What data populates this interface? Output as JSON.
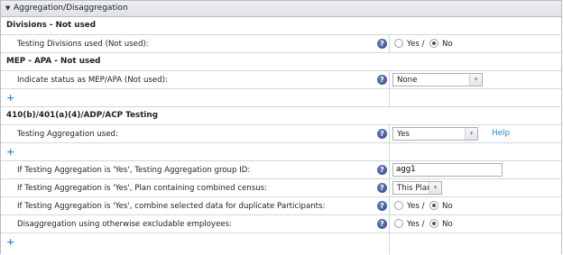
{
  "header": {
    "title": "Aggregation/Disaggregation"
  },
  "sections": {
    "divisions": "Divisions - Not used",
    "mep": "MEP - APA - Not used",
    "testing": "410(b)/401(a)(4)/ADP/ACP Testing"
  },
  "rows": {
    "divisions_used": {
      "label": "Testing Divisions used (Not used):",
      "yes": "Yes /",
      "no": "No",
      "selected": "No"
    },
    "mep_status": {
      "label": "Indicate status as MEP/APA (Not used):",
      "value": "None"
    },
    "aggregation_used": {
      "label": "Testing Aggregation used:",
      "value": "Yes",
      "help_link": "Help"
    },
    "group_id": {
      "label": "If Testing Aggregation is 'Yes', Testing Aggregation group ID:",
      "value": "agg1"
    },
    "combined_census": {
      "label": "If Testing Aggregation is 'Yes', Plan containing combined census:",
      "value": "This Plan"
    },
    "combine_duplicates": {
      "label": "If Testing Aggregation is 'Yes', combine selected data for duplicate Participants:",
      "yes": "Yes /",
      "no": "No",
      "selected": "No"
    },
    "disaggregation": {
      "label": "Disaggregation using otherwise excludable employees:",
      "yes": "Yes /",
      "no": "No",
      "selected": "No"
    }
  },
  "icons": {
    "help": "?",
    "add": "+",
    "collapse": "▼",
    "dropdown": "▾"
  },
  "colors": {
    "link": "#2a86c9",
    "help_icon": "#2c4a8c",
    "add_icon": "#3c8ed1"
  }
}
